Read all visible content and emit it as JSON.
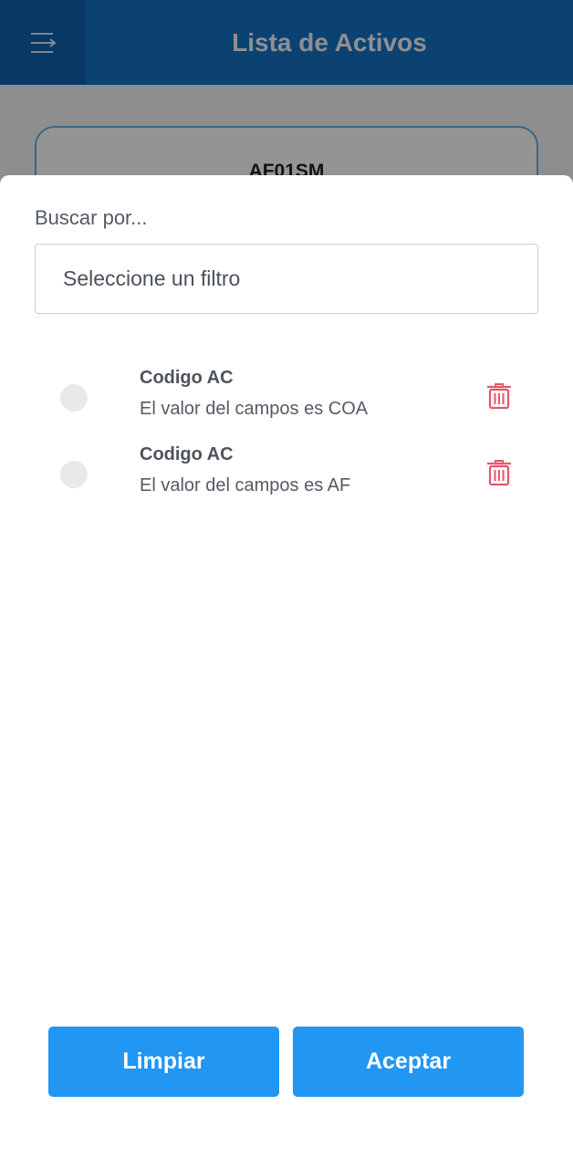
{
  "header": {
    "title": "Lista de Activos",
    "menu_icon": "menu-icon",
    "background_color": "#1473c4"
  },
  "background_card": {
    "title": "AF01SM"
  },
  "sheet": {
    "search_label": "Buscar por...",
    "filter_placeholder": "Seleccione un filtro",
    "filters": [
      {
        "title": "Codigo AC",
        "description": "El valor del campos es COA",
        "selected": false,
        "delete_icon": "trash-icon"
      },
      {
        "title": "Codigo AC",
        "description": "El valor del campos es AF",
        "selected": false,
        "delete_icon": "trash-icon"
      }
    ],
    "clear_label": "Limpiar",
    "accept_label": "Aceptar",
    "button_color": "#2196f3",
    "delete_color": "#e8556b"
  }
}
